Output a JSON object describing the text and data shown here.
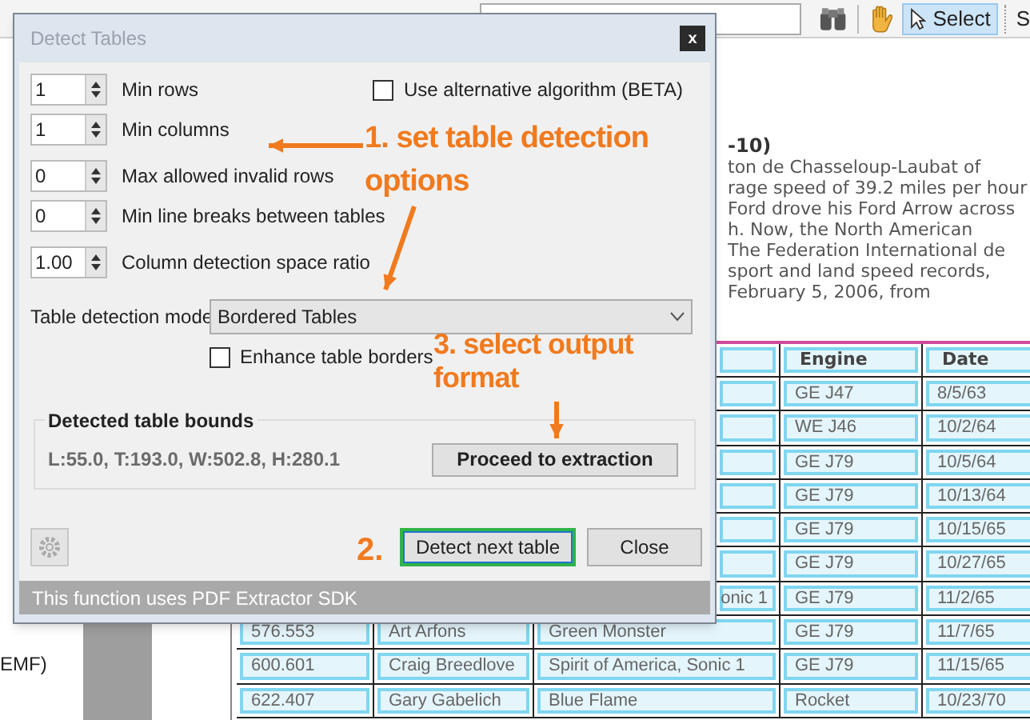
{
  "toolbar": {
    "select_button": {
      "label": "Select",
      "selected": true
    },
    "next_button": "S"
  },
  "left_panel": {
    "text": "EMF)"
  },
  "document": {
    "heading": "-10)",
    "lines": [
      "ton de Chasseloup-Laubat of",
      "rage speed of 39.2 miles per hour",
      "Ford drove his Ford Arrow across",
      "h. Now, the North American",
      "The Federation International de",
      "sport and land speed records,",
      "February 5, 2006, from"
    ]
  },
  "table": {
    "header": [
      "Engine",
      "Date"
    ],
    "rows": [
      {
        "engine": "GE J47",
        "date": "8/5/63"
      },
      {
        "engine": "WE J46",
        "date": "10/2/64"
      },
      {
        "engine": "GE J79",
        "date": "10/5/64"
      },
      {
        "engine": "GE J79",
        "date": "10/13/64"
      },
      {
        "engine": "GE J79",
        "date": "10/15/65"
      },
      {
        "engine": "GE J79",
        "date": "10/27/65"
      },
      {
        "car": "onic 1",
        "engine": "GE J79",
        "date": "11/2/65"
      },
      {
        "speed": "576.553",
        "driver": "Art Arfons",
        "car": "Green Monster",
        "engine": "GE J79",
        "date": "11/7/65"
      },
      {
        "speed": "600.601",
        "driver": "Craig Breedlove",
        "car": "Spirit of America, Sonic 1",
        "engine": "GE J79",
        "date": "11/15/65"
      },
      {
        "speed": "622.407",
        "driver": "Gary Gabelich",
        "car": "Blue Flame",
        "engine": "Rocket",
        "date": "10/23/70"
      }
    ]
  },
  "dialog": {
    "title": "Detect Tables",
    "close_button": "x",
    "spinners": [
      {
        "value": "1",
        "label": "Min rows"
      },
      {
        "value": "1",
        "label": "Min columns"
      },
      {
        "value": "0",
        "label": "Max allowed invalid rows"
      },
      {
        "value": "0",
        "label": "Min line breaks between tables"
      },
      {
        "value": "1.00",
        "label": "Column detection space ratio"
      }
    ],
    "alt_algorithm": {
      "label": "Use alternative algorithm (BETA)",
      "checked": false
    },
    "detection_mode": {
      "label": "Table detection mode",
      "value": "Bordered Tables"
    },
    "enhance_borders": {
      "label": "Enhance table borders",
      "checked": false
    },
    "bounds_group": {
      "title": "Detected table bounds",
      "bounds": "L:55.0, T:193.0, W:502.8, H:280.1",
      "proceed_button": "Proceed to extraction"
    },
    "buttons": [
      {
        "label": "Detect next table",
        "focused": true
      },
      {
        "label": "Close",
        "focused": false
      }
    ],
    "status_bar": "This function uses PDF Extractor SDK"
  },
  "annotations": [
    {
      "text": "1. set table detection options"
    },
    {
      "text": "3. select output format"
    },
    {
      "text": "2."
    }
  ]
}
